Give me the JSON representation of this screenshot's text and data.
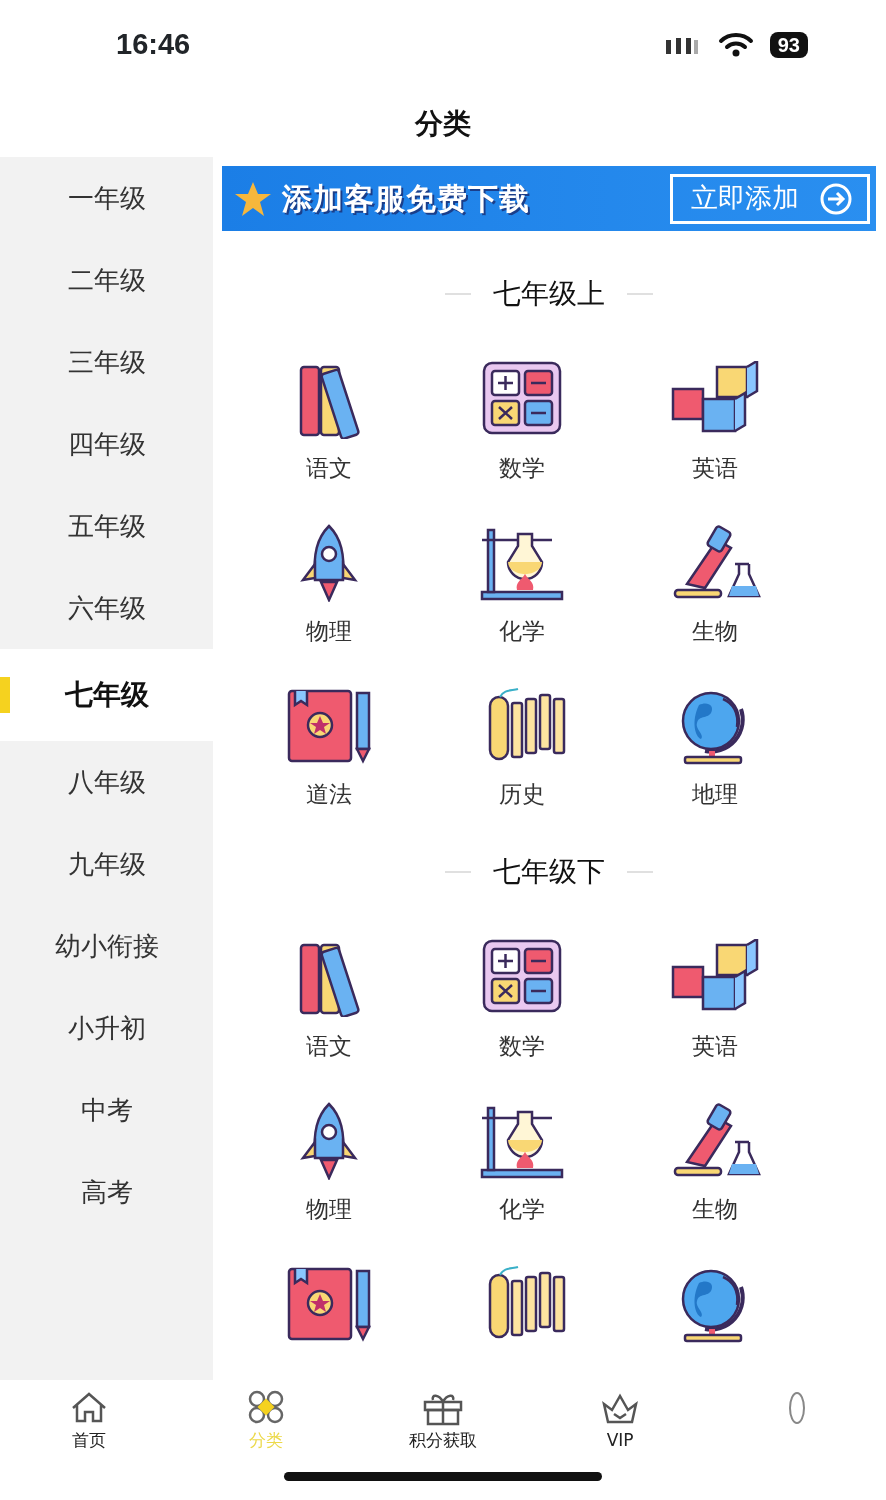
{
  "status_bar": {
    "time": "16:46",
    "battery": "93"
  },
  "header": {
    "title": "分类"
  },
  "sidebar": {
    "items": [
      {
        "label": "一年级",
        "selected": false
      },
      {
        "label": "二年级",
        "selected": false
      },
      {
        "label": "三年级",
        "selected": false
      },
      {
        "label": "四年级",
        "selected": false
      },
      {
        "label": "五年级",
        "selected": false
      },
      {
        "label": "六年级",
        "selected": false
      },
      {
        "label": "七年级",
        "selected": true
      },
      {
        "label": "八年级",
        "selected": false
      },
      {
        "label": "九年级",
        "selected": false
      },
      {
        "label": "幼小衔接",
        "selected": false
      },
      {
        "label": "小升初",
        "selected": false
      },
      {
        "label": "中考",
        "selected": false
      },
      {
        "label": "高考",
        "selected": false
      }
    ]
  },
  "banner": {
    "text": "添加客服免费下载",
    "button": "立即添加"
  },
  "sections": [
    {
      "title": "七年级上",
      "subjects": [
        {
          "kind": "books",
          "label": "语文"
        },
        {
          "kind": "calculator",
          "label": "数学"
        },
        {
          "kind": "blocks",
          "label": "英语"
        },
        {
          "kind": "rocket",
          "label": "物理"
        },
        {
          "kind": "lab",
          "label": "化学"
        },
        {
          "kind": "microscope",
          "label": "生物"
        },
        {
          "kind": "textbook",
          "label": "道法"
        },
        {
          "kind": "scroll",
          "label": "历史"
        },
        {
          "kind": "globe",
          "label": "地理"
        }
      ]
    },
    {
      "title": "七年级下",
      "subjects": [
        {
          "kind": "books",
          "label": "语文"
        },
        {
          "kind": "calculator",
          "label": "数学"
        },
        {
          "kind": "blocks",
          "label": "英语"
        },
        {
          "kind": "rocket",
          "label": "物理"
        },
        {
          "kind": "lab",
          "label": "化学"
        },
        {
          "kind": "microscope",
          "label": "生物"
        },
        {
          "kind": "textbook"
        },
        {
          "kind": "scroll"
        },
        {
          "kind": "globe"
        }
      ]
    }
  ],
  "tab_bar": [
    {
      "kind": "home",
      "label": "首页",
      "selected": false
    },
    {
      "kind": "category",
      "label": "分类",
      "selected": true
    },
    {
      "kind": "gift",
      "label": "积分获取",
      "selected": false
    },
    {
      "kind": "crown",
      "label": "VIP",
      "selected": false
    },
    {
      "kind": "profile",
      "selected": false
    }
  ]
}
